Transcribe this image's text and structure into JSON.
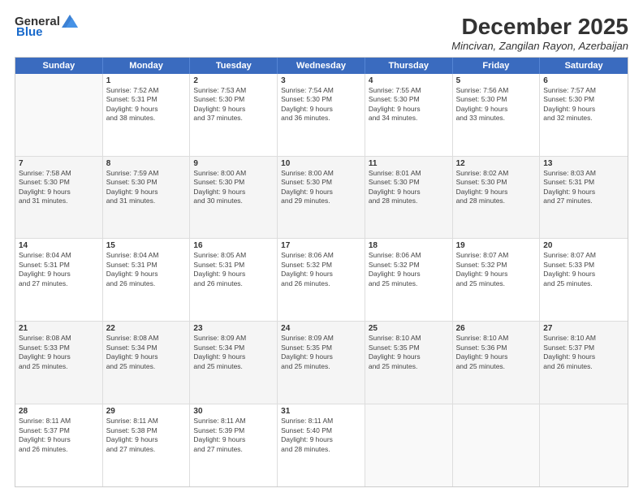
{
  "logo": {
    "general": "General",
    "blue": "Blue"
  },
  "title": "December 2025",
  "subtitle": "Mincivan, Zangilan Rayon, Azerbaijan",
  "calendar": {
    "headers": [
      "Sunday",
      "Monday",
      "Tuesday",
      "Wednesday",
      "Thursday",
      "Friday",
      "Saturday"
    ],
    "rows": [
      [
        {
          "day": "",
          "lines": []
        },
        {
          "day": "1",
          "lines": [
            "Sunrise: 7:52 AM",
            "Sunset: 5:31 PM",
            "Daylight: 9 hours",
            "and 38 minutes."
          ]
        },
        {
          "day": "2",
          "lines": [
            "Sunrise: 7:53 AM",
            "Sunset: 5:30 PM",
            "Daylight: 9 hours",
            "and 37 minutes."
          ]
        },
        {
          "day": "3",
          "lines": [
            "Sunrise: 7:54 AM",
            "Sunset: 5:30 PM",
            "Daylight: 9 hours",
            "and 36 minutes."
          ]
        },
        {
          "day": "4",
          "lines": [
            "Sunrise: 7:55 AM",
            "Sunset: 5:30 PM",
            "Daylight: 9 hours",
            "and 34 minutes."
          ]
        },
        {
          "day": "5",
          "lines": [
            "Sunrise: 7:56 AM",
            "Sunset: 5:30 PM",
            "Daylight: 9 hours",
            "and 33 minutes."
          ]
        },
        {
          "day": "6",
          "lines": [
            "Sunrise: 7:57 AM",
            "Sunset: 5:30 PM",
            "Daylight: 9 hours",
            "and 32 minutes."
          ]
        }
      ],
      [
        {
          "day": "7",
          "lines": [
            "Sunrise: 7:58 AM",
            "Sunset: 5:30 PM",
            "Daylight: 9 hours",
            "and 31 minutes."
          ]
        },
        {
          "day": "8",
          "lines": [
            "Sunrise: 7:59 AM",
            "Sunset: 5:30 PM",
            "Daylight: 9 hours",
            "and 31 minutes."
          ]
        },
        {
          "day": "9",
          "lines": [
            "Sunrise: 8:00 AM",
            "Sunset: 5:30 PM",
            "Daylight: 9 hours",
            "and 30 minutes."
          ]
        },
        {
          "day": "10",
          "lines": [
            "Sunrise: 8:00 AM",
            "Sunset: 5:30 PM",
            "Daylight: 9 hours",
            "and 29 minutes."
          ]
        },
        {
          "day": "11",
          "lines": [
            "Sunrise: 8:01 AM",
            "Sunset: 5:30 PM",
            "Daylight: 9 hours",
            "and 28 minutes."
          ]
        },
        {
          "day": "12",
          "lines": [
            "Sunrise: 8:02 AM",
            "Sunset: 5:30 PM",
            "Daylight: 9 hours",
            "and 28 minutes."
          ]
        },
        {
          "day": "13",
          "lines": [
            "Sunrise: 8:03 AM",
            "Sunset: 5:31 PM",
            "Daylight: 9 hours",
            "and 27 minutes."
          ]
        }
      ],
      [
        {
          "day": "14",
          "lines": [
            "Sunrise: 8:04 AM",
            "Sunset: 5:31 PM",
            "Daylight: 9 hours",
            "and 27 minutes."
          ]
        },
        {
          "day": "15",
          "lines": [
            "Sunrise: 8:04 AM",
            "Sunset: 5:31 PM",
            "Daylight: 9 hours",
            "and 26 minutes."
          ]
        },
        {
          "day": "16",
          "lines": [
            "Sunrise: 8:05 AM",
            "Sunset: 5:31 PM",
            "Daylight: 9 hours",
            "and 26 minutes."
          ]
        },
        {
          "day": "17",
          "lines": [
            "Sunrise: 8:06 AM",
            "Sunset: 5:32 PM",
            "Daylight: 9 hours",
            "and 26 minutes."
          ]
        },
        {
          "day": "18",
          "lines": [
            "Sunrise: 8:06 AM",
            "Sunset: 5:32 PM",
            "Daylight: 9 hours",
            "and 25 minutes."
          ]
        },
        {
          "day": "19",
          "lines": [
            "Sunrise: 8:07 AM",
            "Sunset: 5:32 PM",
            "Daylight: 9 hours",
            "and 25 minutes."
          ]
        },
        {
          "day": "20",
          "lines": [
            "Sunrise: 8:07 AM",
            "Sunset: 5:33 PM",
            "Daylight: 9 hours",
            "and 25 minutes."
          ]
        }
      ],
      [
        {
          "day": "21",
          "lines": [
            "Sunrise: 8:08 AM",
            "Sunset: 5:33 PM",
            "Daylight: 9 hours",
            "and 25 minutes."
          ]
        },
        {
          "day": "22",
          "lines": [
            "Sunrise: 8:08 AM",
            "Sunset: 5:34 PM",
            "Daylight: 9 hours",
            "and 25 minutes."
          ]
        },
        {
          "day": "23",
          "lines": [
            "Sunrise: 8:09 AM",
            "Sunset: 5:34 PM",
            "Daylight: 9 hours",
            "and 25 minutes."
          ]
        },
        {
          "day": "24",
          "lines": [
            "Sunrise: 8:09 AM",
            "Sunset: 5:35 PM",
            "Daylight: 9 hours",
            "and 25 minutes."
          ]
        },
        {
          "day": "25",
          "lines": [
            "Sunrise: 8:10 AM",
            "Sunset: 5:35 PM",
            "Daylight: 9 hours",
            "and 25 minutes."
          ]
        },
        {
          "day": "26",
          "lines": [
            "Sunrise: 8:10 AM",
            "Sunset: 5:36 PM",
            "Daylight: 9 hours",
            "and 25 minutes."
          ]
        },
        {
          "day": "27",
          "lines": [
            "Sunrise: 8:10 AM",
            "Sunset: 5:37 PM",
            "Daylight: 9 hours",
            "and 26 minutes."
          ]
        }
      ],
      [
        {
          "day": "28",
          "lines": [
            "Sunrise: 8:11 AM",
            "Sunset: 5:37 PM",
            "Daylight: 9 hours",
            "and 26 minutes."
          ]
        },
        {
          "day": "29",
          "lines": [
            "Sunrise: 8:11 AM",
            "Sunset: 5:38 PM",
            "Daylight: 9 hours",
            "and 27 minutes."
          ]
        },
        {
          "day": "30",
          "lines": [
            "Sunrise: 8:11 AM",
            "Sunset: 5:39 PM",
            "Daylight: 9 hours",
            "and 27 minutes."
          ]
        },
        {
          "day": "31",
          "lines": [
            "Sunrise: 8:11 AM",
            "Sunset: 5:40 PM",
            "Daylight: 9 hours",
            "and 28 minutes."
          ]
        },
        {
          "day": "",
          "lines": []
        },
        {
          "day": "",
          "lines": []
        },
        {
          "day": "",
          "lines": []
        }
      ]
    ]
  }
}
